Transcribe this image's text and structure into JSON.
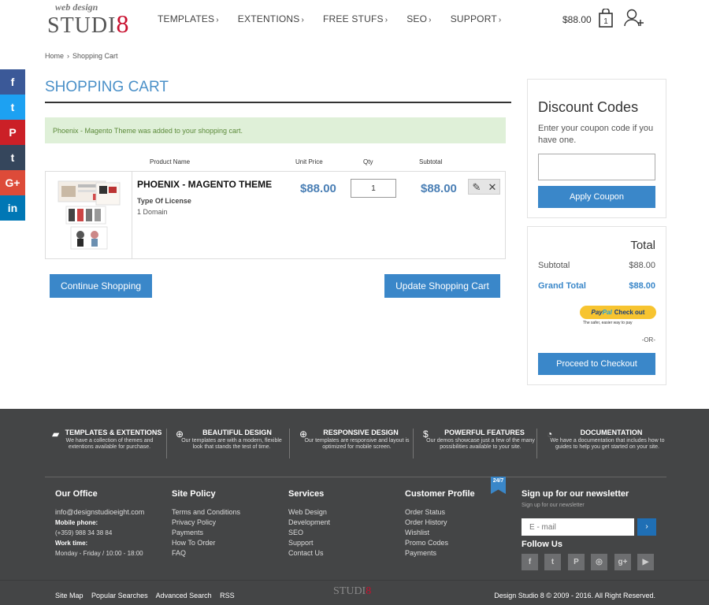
{
  "brand": {
    "logo_small": "web design",
    "logo_big": "STUDI",
    "logo_eight": "8"
  },
  "nav": {
    "items": [
      {
        "label": "TEMPLATES",
        "chev": "›"
      },
      {
        "label": "EXTENTIONS",
        "chev": "›"
      },
      {
        "label": "FREE STUFS",
        "chev": "›"
      },
      {
        "label": "SEO",
        "chev": "›"
      },
      {
        "label": "SUPPORT",
        "chev": "›"
      }
    ],
    "cart_total": "$88.00",
    "cart_count": "1",
    "bag_icon": "shopping-bag-icon",
    "user_icon": "add-user-icon"
  },
  "social": [
    {
      "name": "facebook-icon",
      "glyph": "f",
      "color": "#3b5998"
    },
    {
      "name": "twitter-icon",
      "glyph": "t",
      "color": "#1da1f2"
    },
    {
      "name": "pinterest-icon",
      "glyph": "P",
      "color": "#cb2027"
    },
    {
      "name": "tumblr-icon",
      "glyph": "t",
      "color": "#35465c"
    },
    {
      "name": "google-plus-icon",
      "glyph": "G+",
      "color": "#dd4b39"
    },
    {
      "name": "linkedin-icon",
      "glyph": "in",
      "color": "#0077b5"
    }
  ],
  "breadcrumb": {
    "home": "Home",
    "sep": "›",
    "current": "Shopping Cart"
  },
  "page_title": "SHOPPING CART",
  "success_message": "Phoenix - Magento Theme was added to your shopping cart.",
  "cart": {
    "headers": {
      "product": "Product Name",
      "unit_price": "Unit Price",
      "qty": "Qty",
      "subtotal": "Subtotal"
    },
    "item": {
      "name": "PHOENIX - MAGENTO THEME",
      "option_label": "Type Of License",
      "option_value": "1 Domain",
      "unit_price": "$88.00",
      "qty": "1",
      "subtotal": "$88.00",
      "edit_icon": "pencil-icon",
      "remove_icon": "close-icon"
    },
    "continue_label": "Continue Shopping",
    "update_label": "Update Shopping Cart"
  },
  "discount": {
    "title": "Discount Codes",
    "description": "Enter your coupon code if you have one.",
    "input_value": "",
    "apply_label": "Apply Coupon"
  },
  "totals": {
    "title": "Total",
    "subtotal_label": "Subtotal",
    "subtotal_value": "$88.00",
    "grand_label": "Grand Total",
    "grand_value": "$88.00",
    "paypal_pay": "Pay",
    "paypal_pal": "Pal",
    "paypal_checkout": "Check out",
    "paypal_tagline": "The safer, easier way to pay",
    "or_text": "-OR-",
    "checkout_label": "Proceed to Checkout"
  },
  "features": [
    {
      "icon": "truck-icon",
      "title": "TEMPLATES & EXTENTIONS",
      "desc": "We have a collection of themes and extentions available for purchase."
    },
    {
      "icon": "lifebuoy-icon",
      "title": "BEAUTIFUL DESIGN",
      "desc": "Our templates are with a modern, flexible look that stands the test of time."
    },
    {
      "icon": "lifebuoy-icon",
      "title": "RESPONSIVE DESIGN",
      "desc": "Our templates are responsive and layout is optimized for mobile screen."
    },
    {
      "icon": "dollar-icon",
      "title": "POWERFUL FEATURES",
      "desc": "Our demos showcase just a few of the many possibilities available to your site."
    },
    {
      "icon": "dashboard-icon",
      "title": "DOCUMENTATION",
      "desc": "We have a documentation that includes how to guides to help you get started on your site."
    }
  ],
  "badge": "24/7",
  "office": {
    "title": "Our Office",
    "email": "info@designstudioeight.com",
    "phone_label": "Mobile phone:",
    "phone": "(+359) 988 34 38 84",
    "hours_label": "Work time:",
    "hours": "Monday - Friday / 10:00 - 18:00"
  },
  "policy": {
    "title": "Site Policy",
    "items": [
      "Terms and Conditions",
      "Privacy Policy",
      "Payments",
      "How To Order",
      "FAQ"
    ]
  },
  "services": {
    "title": "Services",
    "items": [
      "Web Design",
      "Development",
      "SEO",
      "Support",
      "Contact Us"
    ]
  },
  "profile": {
    "title": "Customer Profile",
    "items": [
      "Order Status",
      "Order History",
      "Wishlist",
      "Promo Codes",
      "Payments"
    ]
  },
  "newsletter": {
    "title": "Sign up for our newsletter",
    "subtitle": "Sign up for our newsletter",
    "placeholder": "E - mail",
    "go": "›",
    "follow": "Follow Us",
    "icons": [
      {
        "name": "facebook-icon",
        "glyph": "f"
      },
      {
        "name": "twitter-icon",
        "glyph": "t"
      },
      {
        "name": "pinterest-icon",
        "glyph": "P"
      },
      {
        "name": "instagram-icon",
        "glyph": "◎"
      },
      {
        "name": "google-plus-icon",
        "glyph": "g+"
      },
      {
        "name": "youtube-icon",
        "glyph": "▶"
      }
    ]
  },
  "bottom": {
    "links": [
      "Site Map",
      "Popular Searches",
      "Advanced Search",
      "RSS"
    ],
    "logo": "STUDI",
    "logo_eight": "8",
    "copyright": "Design Studio 8 © 2009 - 2016. All Right Reserved."
  }
}
